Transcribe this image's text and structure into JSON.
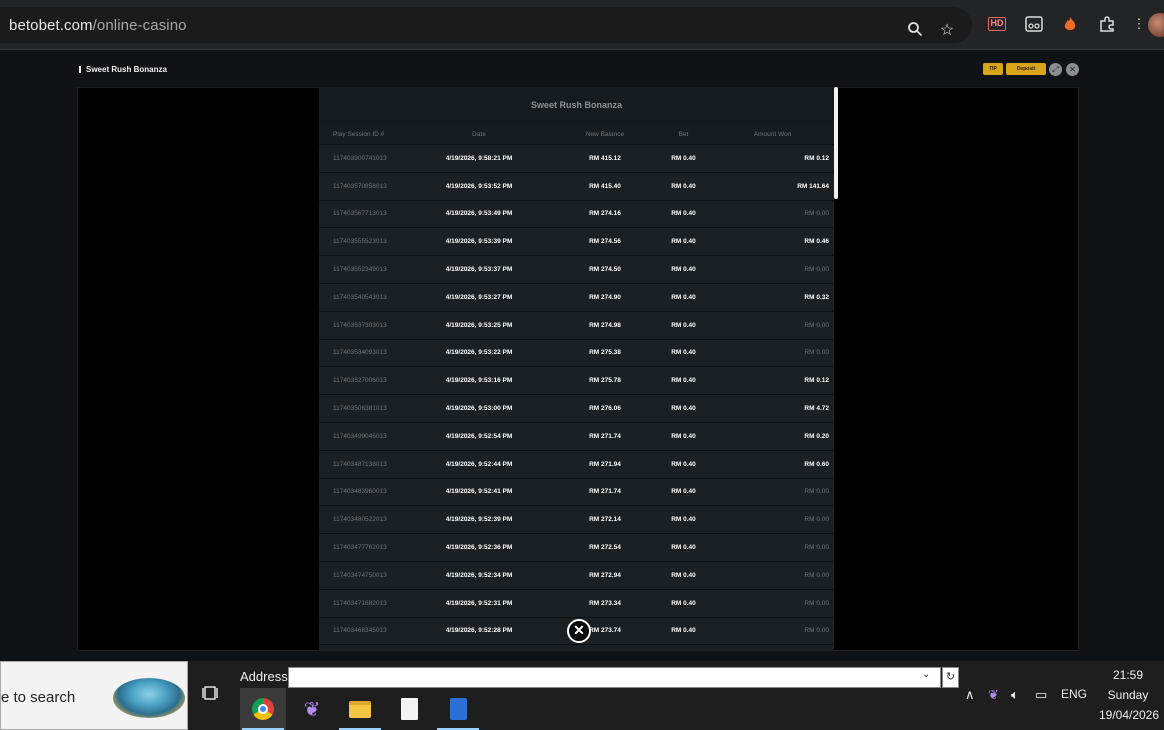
{
  "browser": {
    "url_host": "betobet.com",
    "url_path": "/online-casino"
  },
  "game": {
    "title": "Sweet Rush Bonanza",
    "tip_label": "TIP",
    "deposit_label": "Deposit"
  },
  "history": {
    "title": "Sweet Rush Bonanza",
    "headers": [
      "Play Session ID #",
      "Date",
      "New Balance",
      "Bet",
      "Amount Won"
    ],
    "rows": [
      {
        "id": "117403900741013",
        "date": "4/19/2026, 9:58:21 PM",
        "balance": "RM 415.12",
        "bet": "RM 0.40",
        "won": "RM 0.12",
        "zero": false
      },
      {
        "id": "117403570858013",
        "date": "4/19/2026, 9:53:52 PM",
        "balance": "RM 415.40",
        "bet": "RM 0.40",
        "won": "RM 141.64",
        "zero": false
      },
      {
        "id": "117403567713013",
        "date": "4/19/2026, 9:53:49 PM",
        "balance": "RM 274.16",
        "bet": "RM 0.40",
        "won": "RM 0.00",
        "zero": true
      },
      {
        "id": "117403555523013",
        "date": "4/19/2026, 9:53:39 PM",
        "balance": "RM 274.56",
        "bet": "RM 0.40",
        "won": "RM 0.46",
        "zero": false
      },
      {
        "id": "117403552349013",
        "date": "4/19/2026, 9:53:37 PM",
        "balance": "RM 274.50",
        "bet": "RM 0.40",
        "won": "RM 0.00",
        "zero": true
      },
      {
        "id": "117403540543013",
        "date": "4/19/2026, 9:53:27 PM",
        "balance": "RM 274.90",
        "bet": "RM 0.40",
        "won": "RM 0.32",
        "zero": false
      },
      {
        "id": "117403537303013",
        "date": "4/19/2026, 9:53:25 PM",
        "balance": "RM 274.98",
        "bet": "RM 0.40",
        "won": "RM 0.00",
        "zero": true
      },
      {
        "id": "117403534093013",
        "date": "4/19/2026, 9:53:22 PM",
        "balance": "RM 275.38",
        "bet": "RM 0.40",
        "won": "RM 0.00",
        "zero": true
      },
      {
        "id": "117403527006013",
        "date": "4/19/2026, 9:53:16 PM",
        "balance": "RM 275.78",
        "bet": "RM 0.40",
        "won": "RM 0.12",
        "zero": false
      },
      {
        "id": "117403506381013",
        "date": "4/19/2026, 9:53:00 PM",
        "balance": "RM 276.06",
        "bet": "RM 0.40",
        "won": "RM 4.72",
        "zero": false
      },
      {
        "id": "117403499046013",
        "date": "4/19/2026, 9:52:54 PM",
        "balance": "RM 271.74",
        "bet": "RM 0.40",
        "won": "RM 0.20",
        "zero": false
      },
      {
        "id": "117403487138013",
        "date": "4/19/2026, 9:52:44 PM",
        "balance": "RM 271.94",
        "bet": "RM 0.40",
        "won": "RM 0.60",
        "zero": false
      },
      {
        "id": "117403483960013",
        "date": "4/19/2026, 9:52:41 PM",
        "balance": "RM 271.74",
        "bet": "RM 0.40",
        "won": "RM 0.00",
        "zero": true
      },
      {
        "id": "117403480522013",
        "date": "4/19/2026, 9:52:39 PM",
        "balance": "RM 272.14",
        "bet": "RM 0.40",
        "won": "RM 0.00",
        "zero": true
      },
      {
        "id": "117403477762013",
        "date": "4/19/2026, 9:52:36 PM",
        "balance": "RM 272.54",
        "bet": "RM 0.40",
        "won": "RM 0.00",
        "zero": true
      },
      {
        "id": "117403474750013",
        "date": "4/19/2026, 9:52:34 PM",
        "balance": "RM 272.94",
        "bet": "RM 0.40",
        "won": "RM 0.00",
        "zero": true
      },
      {
        "id": "117403471682013",
        "date": "4/19/2026, 9:52:31 PM",
        "balance": "RM 273.34",
        "bet": "RM 0.40",
        "won": "RM 0.00",
        "zero": true
      },
      {
        "id": "117403468345013",
        "date": "4/19/2026, 9:52:28 PM",
        "balance": "RM 273.74",
        "bet": "RM 0.40",
        "won": "RM 0.00",
        "zero": true
      }
    ]
  },
  "taskbar": {
    "search_text": "e to search",
    "address_label": "Address",
    "address_value": "",
    "language": "ENG",
    "time": "21:59",
    "day": "Sunday",
    "date": "19/04/2026"
  },
  "icons": {
    "zoom": "magnifier-icon",
    "bookmark": "star-icon",
    "hd": "HD",
    "close": "close-circle-icon"
  },
  "colors": {
    "accent_gold": "#d9a51a",
    "panel_bg": "#1a2024"
  }
}
